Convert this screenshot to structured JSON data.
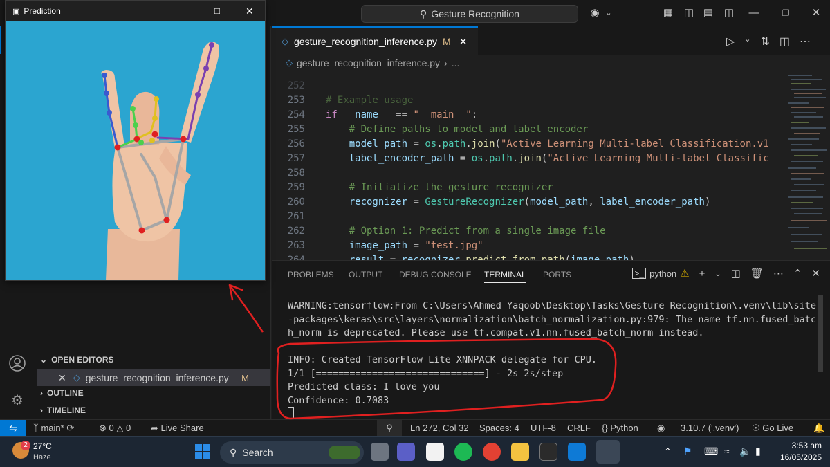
{
  "title_bar": {
    "search_text": "Gesture Recognition"
  },
  "prediction_window": {
    "title": "Prediction"
  },
  "editor": {
    "tab": {
      "filename": "gesture_recognition_inference.py",
      "badge": "M"
    },
    "breadcrumb": {
      "file": "gesture_recognition_inference.py",
      "more": "..."
    },
    "lines": [
      {
        "num": "252",
        "text": "# Example usage"
      },
      {
        "num": "253",
        "text": "if __name__ == \"__main__\":"
      },
      {
        "num": "254",
        "text": "    # Define paths to model and label encoder"
      },
      {
        "num": "255",
        "text": "    model_path = os.path.join(\"Active Learning Multi-label Classification.v1"
      },
      {
        "num": "256",
        "text": "    label_encoder_path = os.path.join(\"Active Learning Multi-label Classific"
      },
      {
        "num": "257",
        "text": ""
      },
      {
        "num": "258",
        "text": "    # Initialize the gesture recognizer"
      },
      {
        "num": "259",
        "text": "    recognizer = GestureRecognizer(model_path, label_encoder_path)"
      },
      {
        "num": "260",
        "text": ""
      },
      {
        "num": "261",
        "text": "    # Option 1: Predict from a single image file"
      },
      {
        "num": "262",
        "text": "    image_path = \"test.jpg\""
      },
      {
        "num": "263",
        "text": "    result = recognizer.predict_from_path(image_path)"
      },
      {
        "num": "264",
        "text": ""
      }
    ]
  },
  "sidebar": {
    "open_editors": "OPEN EDITORS",
    "open_file": "gesture_recognition_inference.py",
    "open_file_badge": "M",
    "outline": "OUTLINE",
    "timeline": "TIMELINE"
  },
  "panel": {
    "tabs": [
      "PROBLEMS",
      "OUTPUT",
      "DEBUG CONSOLE",
      "TERMINAL",
      "PORTS"
    ],
    "shell": "python",
    "terminal_lines": [
      "WARNING:tensorflow:From C:\\Users\\Ahmed Yaqoob\\Desktop\\Tasks\\Gesture Recognition\\.venv\\lib\\site",
      "-packages\\keras\\src\\layers\\normalization\\batch_normalization.py:979: The name tf.nn.fused_batc",
      "h_norm is deprecated. Please use tf.compat.v1.nn.fused_batch_norm instead.",
      "",
      "INFO: Created TensorFlow Lite XNNPACK delegate for CPU.",
      "1/1 [==============================] - 2s 2s/step",
      "Predicted class: I love you",
      "Confidence: 0.7083"
    ]
  },
  "status_bar": {
    "branch": "main*",
    "errors": "0",
    "warnings": "0",
    "live_share": "Live Share",
    "position": "Ln 272, Col 32",
    "spaces": "Spaces: 4",
    "encoding": "UTF-8",
    "eol": "CRLF",
    "language": "Python",
    "interpreter": "3.10.7 ('.venv')",
    "go_live": "Go Live"
  },
  "taskbar": {
    "weather_temp": "27°C",
    "weather_desc": "Haze",
    "weather_badge": "2",
    "search_label": "Search",
    "time": "3:53 am",
    "date": "16/05/2025"
  },
  "colors": {
    "accent": "#0078d4",
    "annotation_red": "#e02020",
    "window_background": "#2ba5d0"
  }
}
